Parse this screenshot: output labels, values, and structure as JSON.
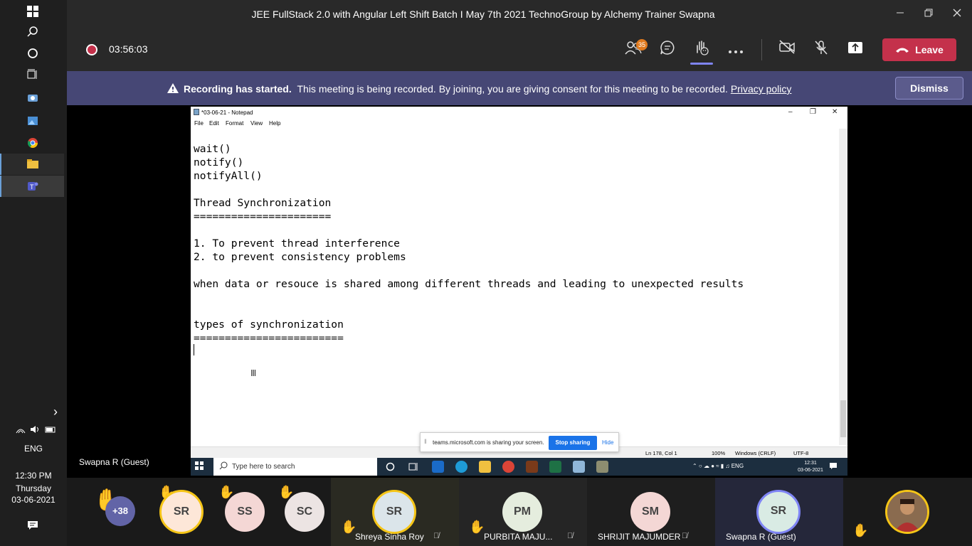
{
  "host_taskbar": {
    "icons": [
      "windows-logo-icon",
      "search-icon",
      "cortana-icon",
      "task-view-icon",
      "camera-app-icon",
      "photos-icon",
      "chrome-icon",
      "file-explorer-icon",
      "teams-icon"
    ],
    "chevron": "›",
    "language": "ENG",
    "time": "12:30 PM",
    "day": "Thursday",
    "date": "03-06-2021"
  },
  "window": {
    "title": "JEE FullStack 2.0 with Angular Left Shift Batch I May 7th 2021 TechnoGroup by Alchemy Trainer Swapna"
  },
  "meeting_bar": {
    "timer": "03:56:03",
    "participants_badge": "35",
    "leave_label": "Leave"
  },
  "recording_banner": {
    "title": "Recording has started.",
    "message": "This meeting is being recorded. By joining, you are giving consent for this meeting to be recorded.",
    "link": "Privacy policy",
    "dismiss_label": "Dismiss"
  },
  "shared_screen": {
    "notepad": {
      "title": "*03-06-21 - Notepad",
      "menu": [
        "File",
        "Edit",
        "Format",
        "View",
        "Help"
      ],
      "lines": [
        "wait()",
        "notify()",
        "notifyAll()",
        "",
        "Thread Synchronization",
        "======================",
        "",
        "1. To prevent thread interference",
        "2. to prevent consistency problems",
        "",
        "when data or resouce is shared among different threads and leading to unexpected results",
        "",
        "",
        "types of synchronization",
        "========================"
      ],
      "status": {
        "position": "Ln 178, Col 1",
        "zoom": "100%",
        "line_endings": "Windows (CRLF)",
        "encoding": "UTF-8"
      }
    },
    "share_bar": {
      "message": "teams.microsoft.com is sharing your screen.",
      "stop_label": "Stop sharing",
      "hide_label": "Hide"
    },
    "inner_taskbar": {
      "search_placeholder": "Type here to search",
      "tray_language": "ENG",
      "clock_time": "12:31",
      "clock_date": "03-06-2021"
    }
  },
  "presenter_label": "Swapna R (Guest)",
  "participants": {
    "overflow": "+38",
    "avatars": [
      {
        "initials": "SR",
        "color": "#fde7d8"
      },
      {
        "initials": "SS",
        "color": "#f4d7d5"
      },
      {
        "initials": "SC",
        "color": "#ece4e3"
      }
    ],
    "tiles": [
      {
        "initials": "SR",
        "name": "Shreya Sinha Roy",
        "color": "#dbe5ea"
      },
      {
        "initials": "PM",
        "name": "PURBITA MAJU...",
        "color": "#e5edde"
      },
      {
        "initials": "SM",
        "name": "SHRIJIT MAJUMDER",
        "color": "#f4d7d5"
      },
      {
        "initials": "SR",
        "name": "Swapna R (Guest)",
        "color": "#d9ebe4"
      }
    ]
  },
  "colors": {
    "teams_purple": "#464775",
    "leave_red": "#c4314b",
    "raised_hand": "#f5c517"
  }
}
